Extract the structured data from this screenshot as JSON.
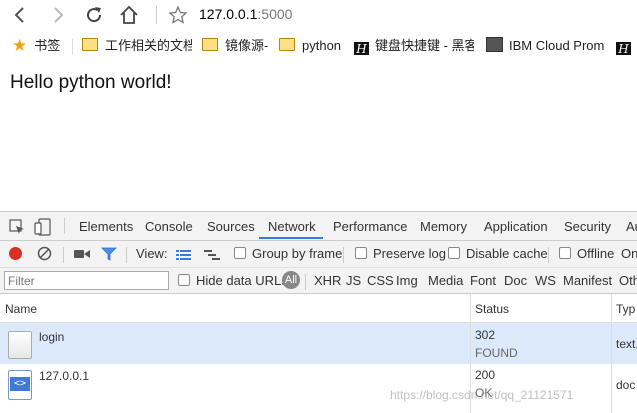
{
  "browser": {
    "url_host": "127.0.0.1",
    "url_port": ":5000",
    "bookmarks": [
      {
        "label": "书签",
        "icon": "star-icon"
      },
      {
        "label": "工作相关的文档",
        "icon": "folder-icon"
      },
      {
        "label": "镜像源-",
        "icon": "folder-icon"
      },
      {
        "label": "python",
        "icon": "folder-icon"
      },
      {
        "label": "键盘快捷键 - 黑客",
        "icon": "h-logo-icon"
      },
      {
        "label": "IBM Cloud Prom",
        "icon": "ibm-icon"
      },
      {
        "label": "",
        "icon": "h-logo-icon"
      }
    ]
  },
  "page": {
    "heading": "Hello python world!"
  },
  "devtools": {
    "tabs": [
      "Elements",
      "Console",
      "Sources",
      "Network",
      "Performance",
      "Memory",
      "Application",
      "Security",
      "Au"
    ],
    "active_tab": "Network",
    "toolbar": {
      "view_label": "View:",
      "group_by_frame": "Group by frame",
      "preserve_log": "Preserve log",
      "disable_cache": "Disable cache",
      "offline": "Offline",
      "online": "On"
    },
    "filter": {
      "placeholder": "Filter",
      "hide_data_urls": "Hide data URLs",
      "all": "All",
      "types": [
        "XHR",
        "JS",
        "CSS",
        "Img",
        "Media",
        "Font",
        "Doc",
        "WS",
        "Manifest",
        "Oth"
      ]
    },
    "table": {
      "columns": [
        "Name",
        "Status",
        "Typ"
      ],
      "rows": [
        {
          "name": "login",
          "status_code": "302",
          "status_text": "FOUND",
          "type": "text,"
        },
        {
          "name": "127.0.0.1",
          "status_code": "200",
          "status_text": "OK",
          "type": "doc"
        }
      ]
    }
  },
  "watermark": "https://blog.csdn.net/qq_21121571"
}
